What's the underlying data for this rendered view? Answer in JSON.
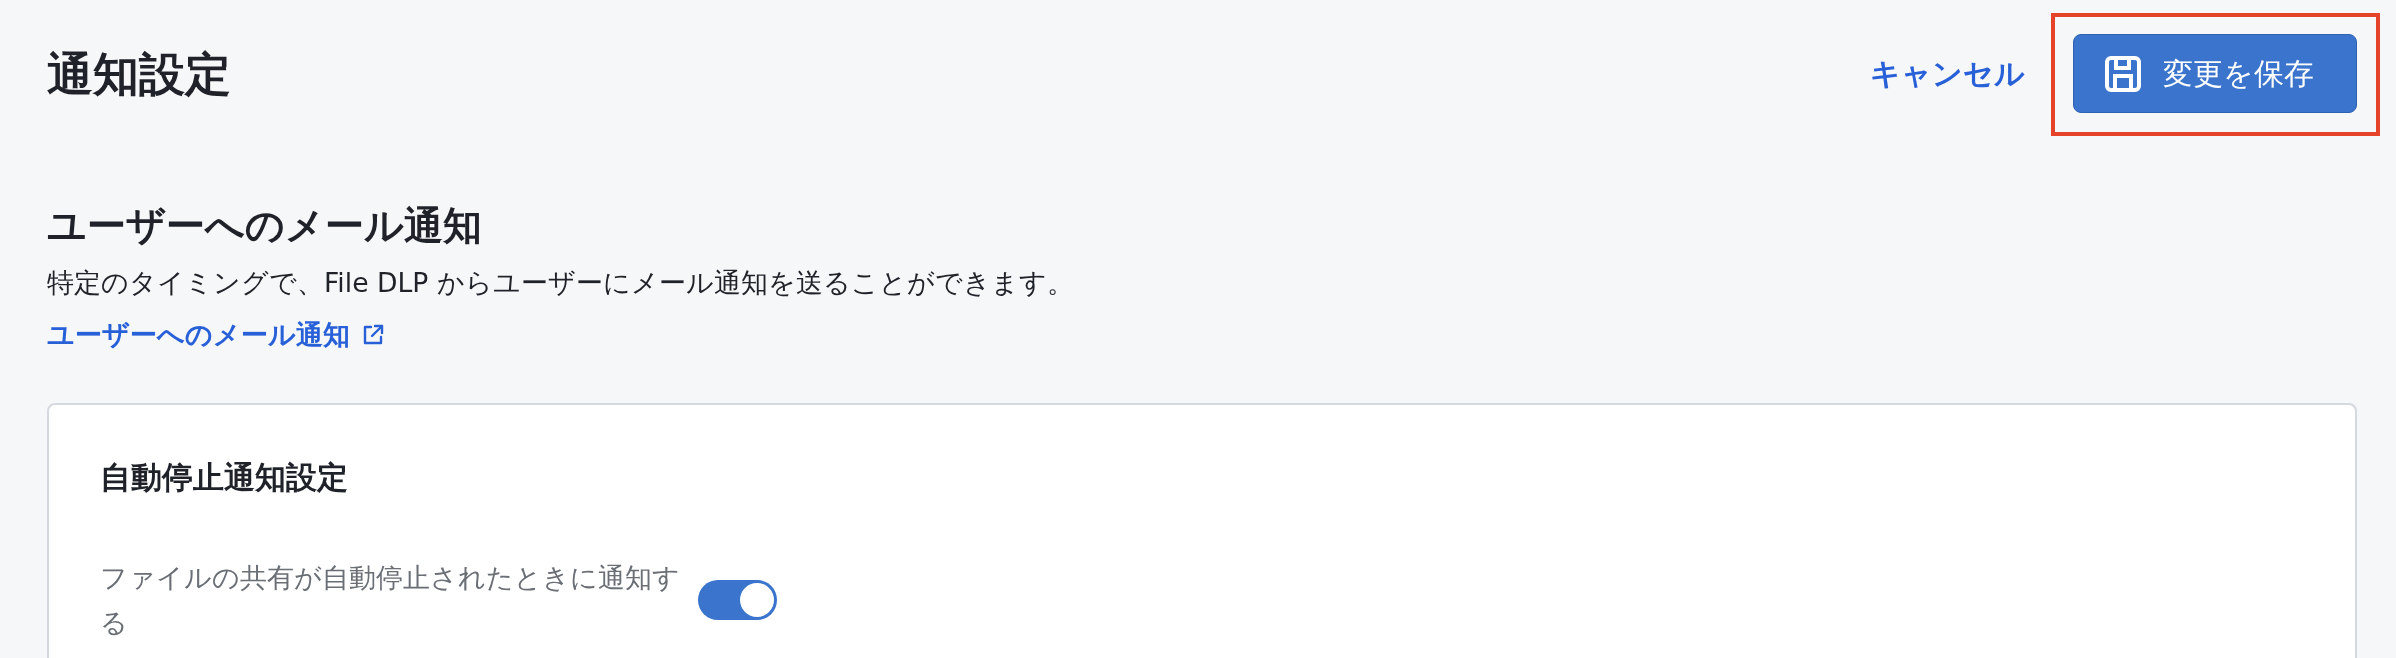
{
  "page": {
    "title": "通知設定"
  },
  "actions": [
    {
      "kind": "link",
      "label": "キャンセル",
      "highlighted": false
    },
    {
      "kind": "primary",
      "label": "変更を保存",
      "highlighted": true
    }
  ],
  "section": {
    "heading": "ユーザーへのメール通知",
    "description": "特定のタイミングで、File DLP からユーザーにメール通知を送ることができます。",
    "link": {
      "label": "ユーザーへのメール通知"
    }
  },
  "card": {
    "heading": "自動停止通知設定",
    "settings": [
      {
        "label": "ファイルの共有が自動停止されたときに通知する",
        "on": true
      }
    ]
  }
}
